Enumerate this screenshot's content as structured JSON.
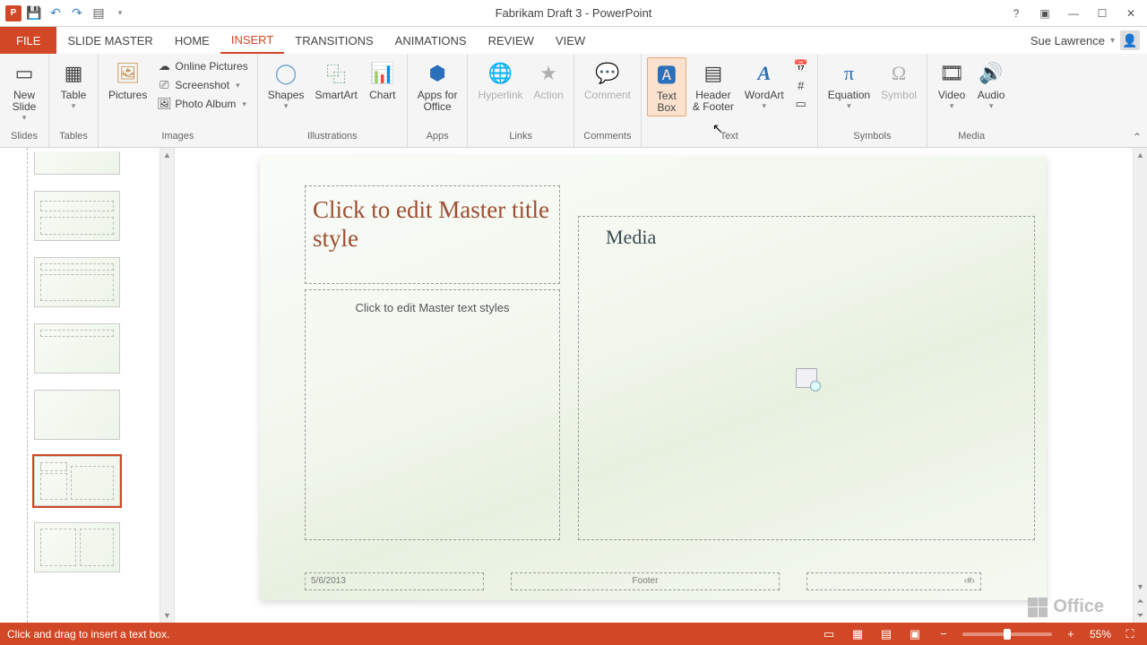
{
  "title": "Fabrikam Draft 3 - PowerPoint",
  "user": {
    "name": "Sue Lawrence"
  },
  "qat": {
    "save": "💾",
    "undo": "↶",
    "redo": "↷",
    "present": "▦"
  },
  "tabs": {
    "file": "FILE",
    "items": [
      "SLIDE MASTER",
      "HOME",
      "INSERT",
      "TRANSITIONS",
      "ANIMATIONS",
      "REVIEW",
      "VIEW"
    ],
    "active": "INSERT"
  },
  "ribbon": {
    "slides": {
      "new_slide": "New\nSlide",
      "group": "Slides"
    },
    "tables": {
      "table": "Table",
      "group": "Tables"
    },
    "images": {
      "pictures": "Pictures",
      "online_pictures": "Online Pictures",
      "screenshot": "Screenshot",
      "photo_album": "Photo Album",
      "group": "Images"
    },
    "illustrations": {
      "shapes": "Shapes",
      "smartart": "SmartArt",
      "chart": "Chart",
      "group": "Illustrations"
    },
    "apps": {
      "apps": "Apps for\nOffice",
      "group": "Apps"
    },
    "links": {
      "hyperlink": "Hyperlink",
      "action": "Action",
      "group": "Links"
    },
    "comments": {
      "comment": "Comment",
      "group": "Comments"
    },
    "text": {
      "textbox": "Text\nBox",
      "header_footer": "Header\n& Footer",
      "wordart": "WordArt",
      "group": "Text"
    },
    "symbols": {
      "equation": "Equation",
      "symbol": "Symbol",
      "group": "Symbols"
    },
    "media": {
      "video": "Video",
      "audio": "Audio",
      "group": "Media"
    }
  },
  "slide": {
    "title_placeholder": "Click to edit Master title style",
    "body_placeholder": "Click to edit Master text styles",
    "media_label": "Media",
    "date": "5/6/2013",
    "footer": "Footer",
    "slide_number": "‹#›"
  },
  "office_brand": "Office",
  "status": {
    "message": "Click and drag to insert a text box.",
    "zoom": "55%"
  }
}
